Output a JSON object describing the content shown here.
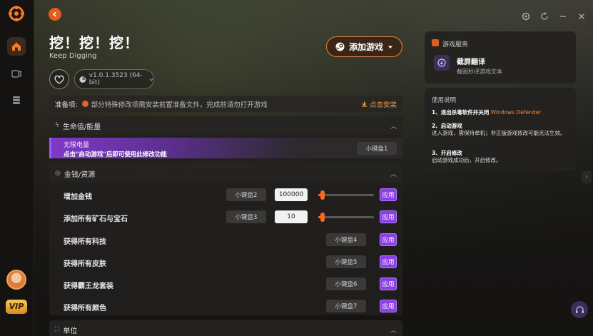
{
  "sidebar": {
    "logo_icon": "app-logo-icon",
    "items": [
      {
        "icon": "home-icon",
        "active": true
      },
      {
        "icon": "games-icon",
        "active": false
      },
      {
        "icon": "library-icon",
        "active": false
      }
    ],
    "vip_label": "VIP"
  },
  "colors": {
    "accent": "#ff6a1a",
    "purple": "#8b3fe6",
    "orange_text": "#f0a13f"
  },
  "header": {
    "title": "挖！挖！挖！",
    "subtitle": "Keep Digging",
    "add_game_label": "添加游戏",
    "version": "v1.0.1.3523 (64-bit)"
  },
  "notice": {
    "label": "准备项:",
    "message": "部分特殊修改项需安装前置准备文件，完成前请勿打开游戏",
    "install_label": "点击安装"
  },
  "sections": [
    {
      "title": "生命值/能量",
      "rows": [
        {
          "label": "无限电量",
          "hint": "点击\"启动游戏\"后即可使用此修改功能",
          "key": "小键盘1"
        }
      ]
    },
    {
      "title": "金钱/资源",
      "rows": [
        {
          "label": "增加金钱",
          "key": "小键盘2",
          "value": "100000",
          "slider": 0.05,
          "apply": "应用"
        },
        {
          "label": "添加所有矿石与宝石",
          "key": "小键盘3",
          "value": "10",
          "slider": 0.05,
          "apply": "应用"
        },
        {
          "label": "获得所有科技",
          "key": "小键盘4",
          "apply": "应用"
        },
        {
          "label": "获得所有皮肤",
          "key": "小键盘5",
          "apply": "应用"
        },
        {
          "label": "获得霸王龙套装",
          "key": "小键盘6",
          "apply": "应用"
        },
        {
          "label": "获得所有颜色",
          "key": "小键盘7",
          "apply": "应用"
        }
      ]
    },
    {
      "title": "单位",
      "rows": []
    }
  ],
  "game_service": {
    "title": "游戏服务",
    "name": "截屏翻译",
    "desc": "截图秒译游戏文本"
  },
  "help": {
    "title": "使用说明",
    "items": [
      {
        "num": "1、",
        "head": "退出杀毒软件并关闭",
        "accent": "Windows Defender",
        "body": ""
      },
      {
        "num": "2、",
        "head": "启动游戏",
        "body": "进入游戏，需保持单机；非正版游戏修改可能无法生效。"
      },
      {
        "num": "3、",
        "head": "开启修改",
        "body": "启动游戏成功后，开启修改。"
      }
    ]
  }
}
